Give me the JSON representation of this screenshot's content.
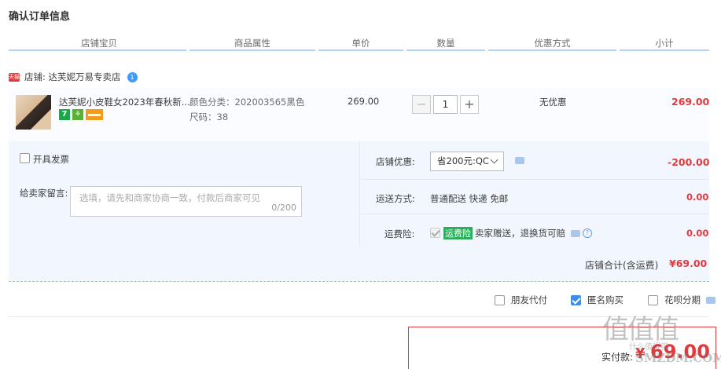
{
  "page": {
    "title": "确认订单信息"
  },
  "columns": [
    "店铺宝贝",
    "商品属性",
    "单价",
    "数量",
    "优惠方式",
    "小计"
  ],
  "shop": {
    "badge": "天猫",
    "label": "店铺: 达芙妮万易专卖店",
    "ww_badge": "1"
  },
  "item": {
    "name": "达芙妮小皮鞋女2023年春秋新...",
    "badges": [
      "7",
      "⚘"
    ],
    "attr_color": "颜色分类：202003565黑色",
    "attr_size": "尺码：38",
    "unit_price": "269.00",
    "quantity": "1",
    "qty_minus": "−",
    "qty_plus": "+",
    "discount": "无优惠",
    "subtotal": "269.00"
  },
  "invoice": {
    "label": "开具发票",
    "checked": false
  },
  "message": {
    "label": "给卖家留言:",
    "placeholder": "选填，请先和商家协商一致，付款后商家可见",
    "counter": "0/200"
  },
  "shop_discount": {
    "label": "店铺优惠:",
    "selected": "省200元:QC",
    "amount": "-200.00"
  },
  "shipping": {
    "label": "运送方式:",
    "value": "普通配送 快递 免邮",
    "amount": "0.00"
  },
  "insurance": {
    "label": "运费险:",
    "tag": "运费险",
    "desc": "卖家赠送，退换货可赔",
    "help": "?",
    "amount": "0.00",
    "checked": true
  },
  "shop_total": {
    "label": "店铺合计(含运费)",
    "value": "¥69.00"
  },
  "options": [
    {
      "label": "朋友代付",
      "checked": false
    },
    {
      "label": "匿名购买",
      "checked": true
    },
    {
      "label": "花呗分期",
      "checked": false
    }
  ],
  "payment": {
    "label": "实付款:",
    "value": "69.00",
    "currency": "¥"
  },
  "watermark": {
    "text": "值值值",
    "sub": "什么值得买",
    "url": "SMZDM.COM"
  },
  "colors": {
    "accent_red": "#e4393c",
    "header_line": "#b2d1ff",
    "panel_bg": "#f2f7ff",
    "link_blue": "#3d8eea"
  }
}
